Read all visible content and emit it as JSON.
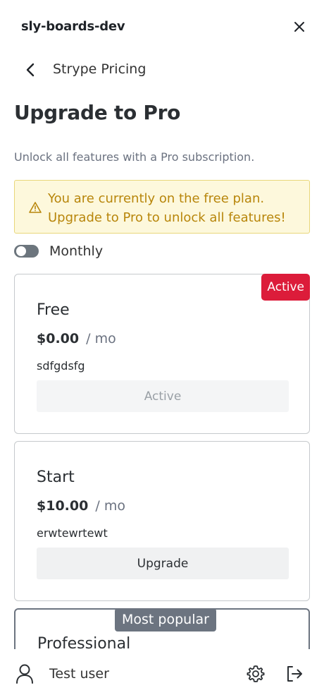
{
  "header": {
    "app_title": "sly-boards-dev"
  },
  "nav": {
    "title": "Strype Pricing"
  },
  "page": {
    "title": "Upgrade to Pro",
    "subtitle": "Unlock all features with a Pro subscription."
  },
  "alert": {
    "text": "You are currently on the free plan. Upgrade to Pro to unlock all features!",
    "icon": "warning-icon"
  },
  "billing_toggle": {
    "label": "Monthly",
    "checked": false
  },
  "plans": [
    {
      "name": "Free",
      "price": "$0.00",
      "period": "/ mo",
      "description": "sdfgdsfg",
      "button_label": "Active",
      "badge": "Active",
      "button_disabled": true
    },
    {
      "name": "Start",
      "price": "$10.00",
      "period": "/ mo",
      "description": "erwtewrtewt",
      "button_label": "Upgrade",
      "button_disabled": false
    },
    {
      "name": "Professional",
      "badge": "Most popular"
    }
  ],
  "footer": {
    "user_name": "Test user"
  },
  "colors": {
    "accent_red": "#dc1c3a",
    "alert_bg": "#fdf8dc",
    "alert_text": "#b8860b",
    "toggle_off": "#6c757d",
    "popular_badge": "#6c7480"
  }
}
